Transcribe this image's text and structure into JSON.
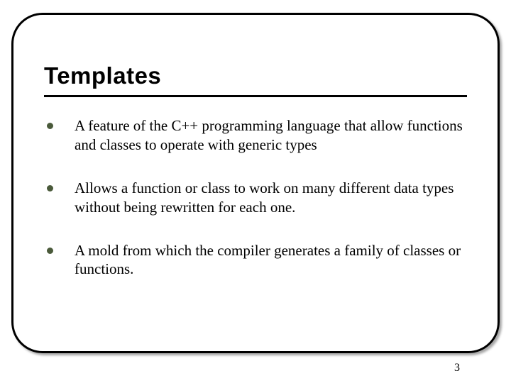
{
  "title": "Templates",
  "bullets": [
    "A feature of the C++ programming language that allow functions and classes to operate with generic types",
    "Allows a function or class to work on many different data types without being rewritten for each one.",
    "A mold from which the compiler generates a family of classes or functions."
  ],
  "page_number": "3",
  "colors": {
    "bullet": "#4a5a3a",
    "frame": "#000000"
  }
}
